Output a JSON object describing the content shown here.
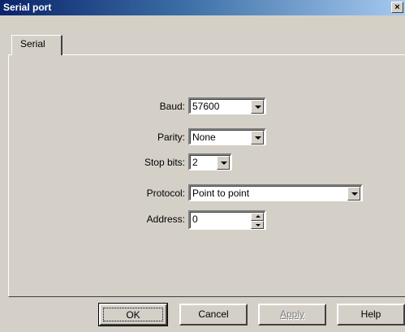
{
  "window": {
    "title": "Serial port",
    "close_label": "×"
  },
  "tabs": [
    {
      "label": "Serial"
    }
  ],
  "form": {
    "baud": {
      "label": "Baud:",
      "value": "57600"
    },
    "parity": {
      "label": "Parity:",
      "value": "None"
    },
    "stop_bits": {
      "label": "Stop bits:",
      "value": "2"
    },
    "protocol": {
      "label": "Protocol:",
      "value": "Point to point"
    },
    "address": {
      "label": "Address:",
      "value": "0"
    }
  },
  "buttons": {
    "ok": "OK",
    "cancel": "Cancel",
    "apply": "Apply",
    "help": "Help"
  }
}
